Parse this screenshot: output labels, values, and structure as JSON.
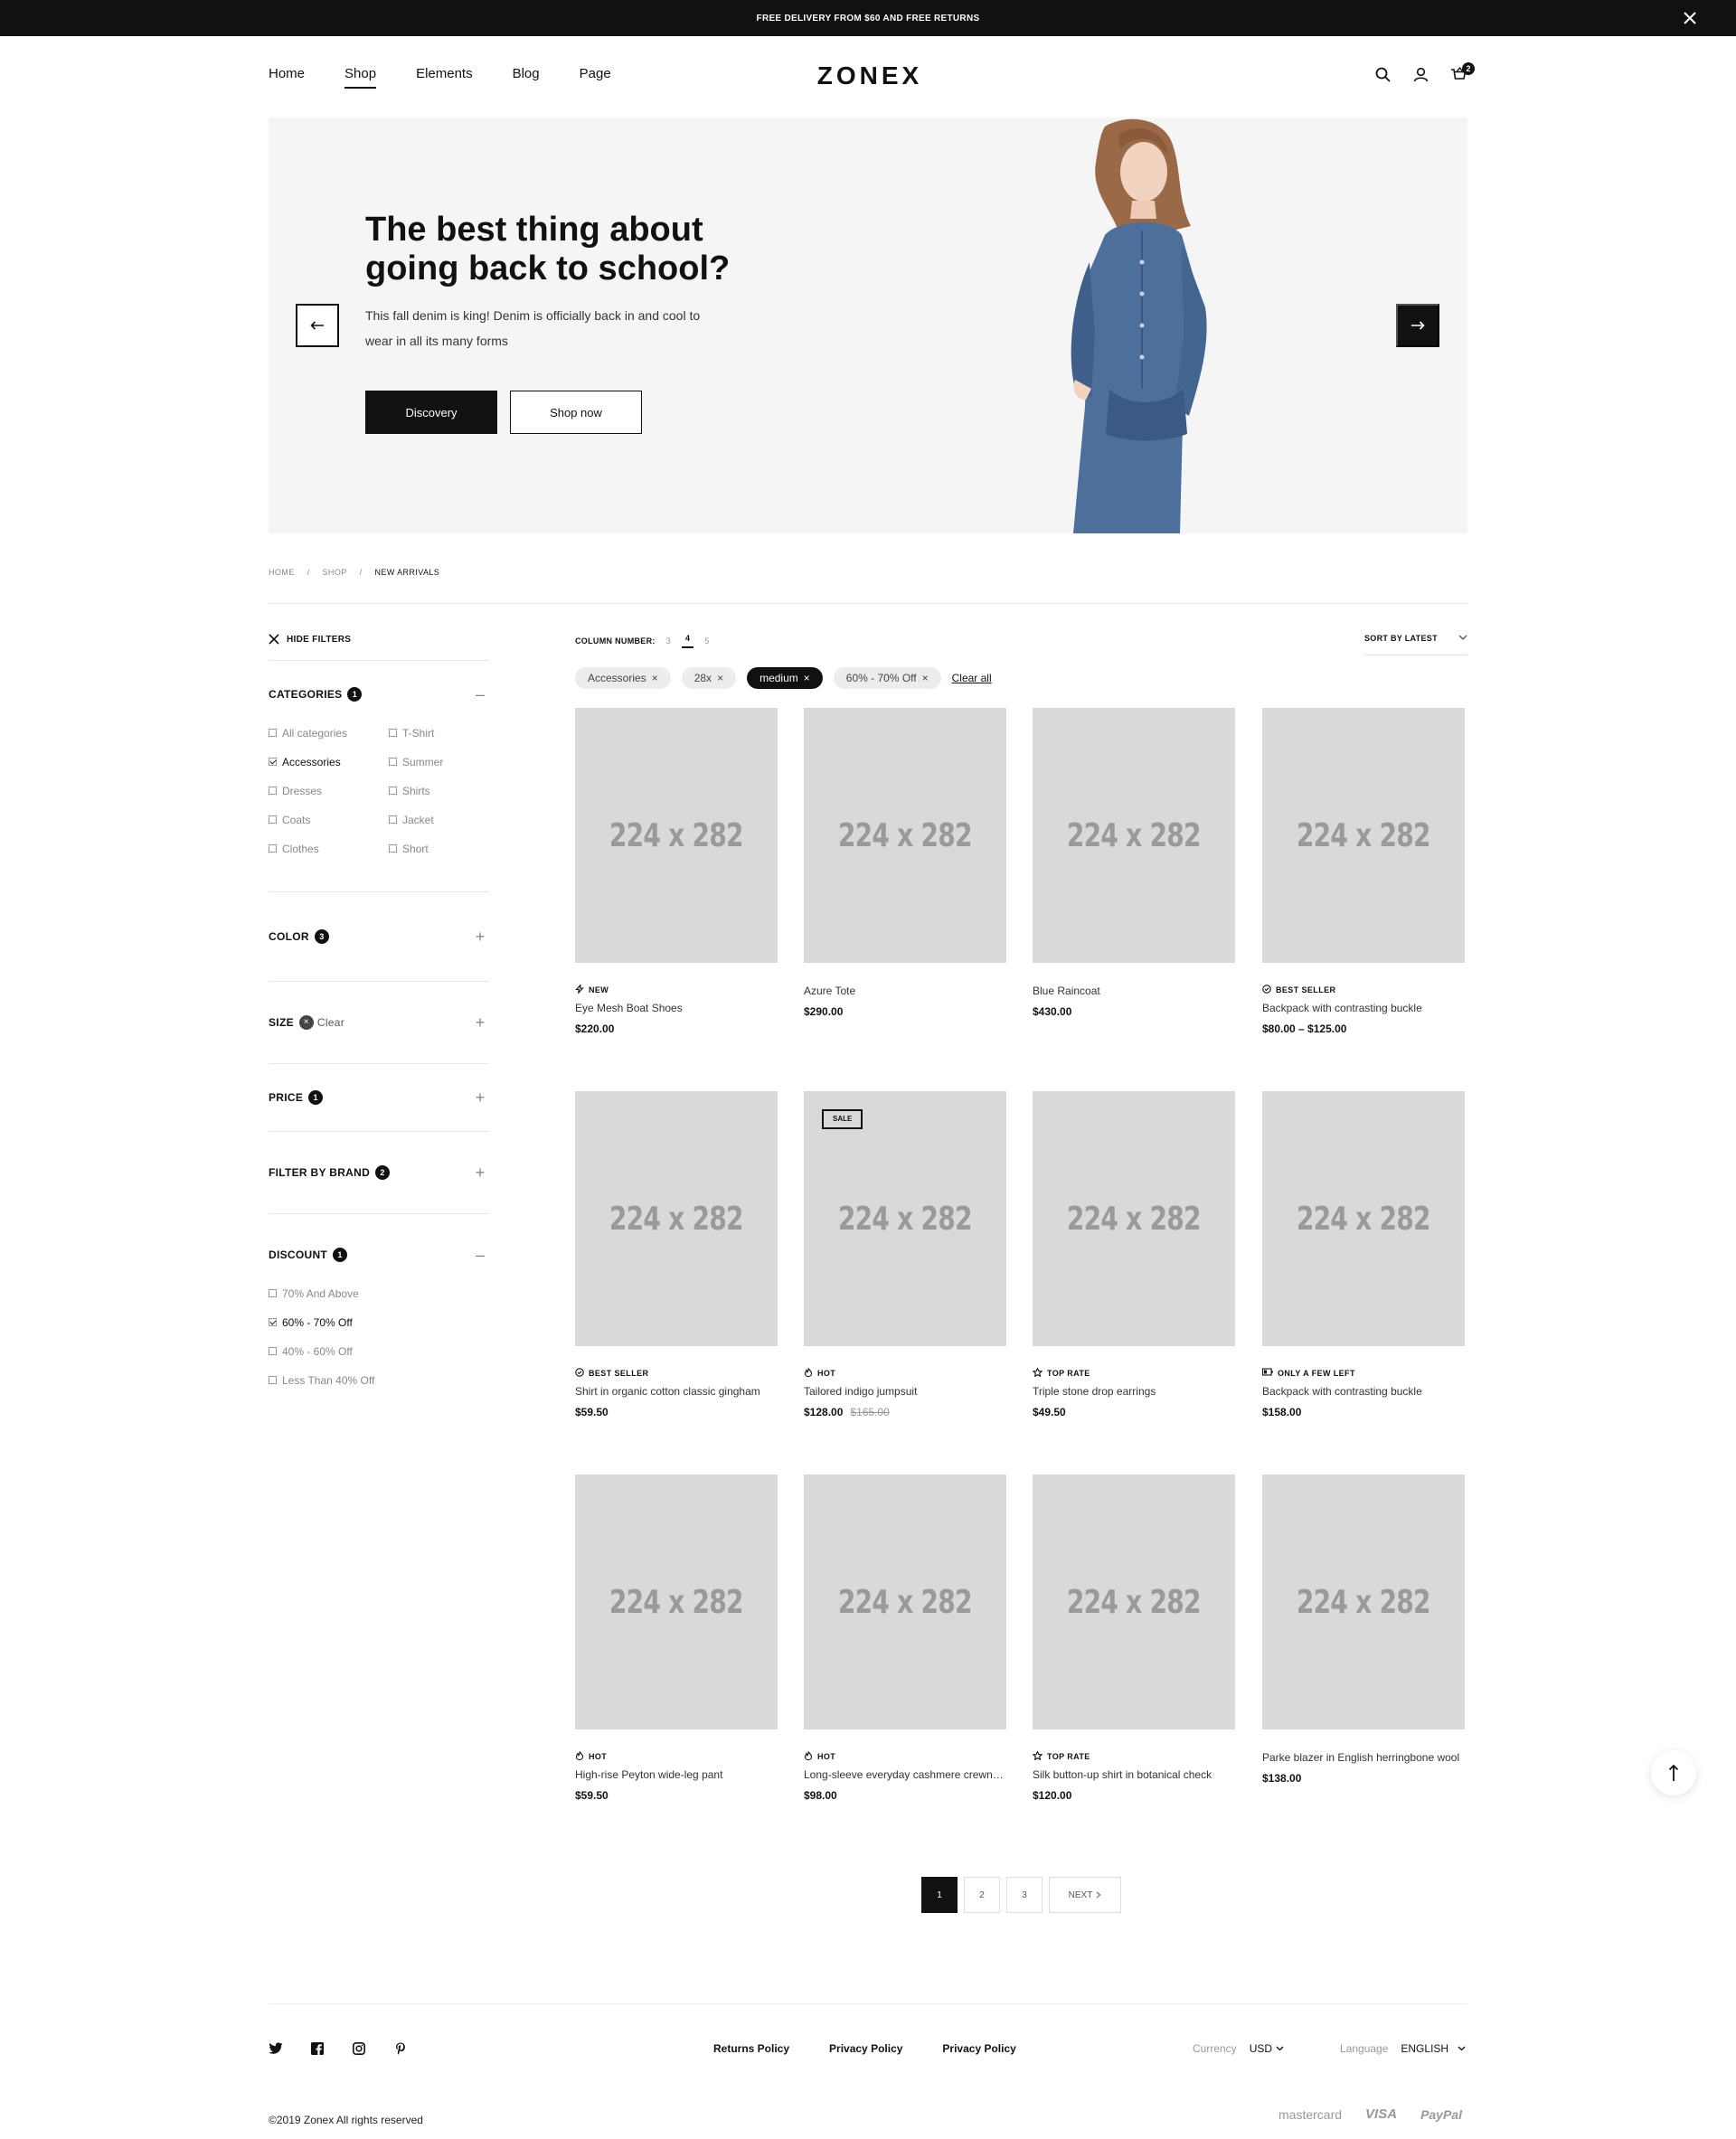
{
  "announcement": "FREE DELIVERY FROM $60 AND FREE RETURNS",
  "nav": [
    "Home",
    "Shop",
    "Elements",
    "Blog",
    "Page"
  ],
  "logo": "ZONEX",
  "cart_count": "2",
  "hero": {
    "title": "The best thing about going back to school?",
    "text": "This fall denim is king! Denim is officially back in and cool to wear in all its many forms",
    "btn_primary": "Discovery",
    "btn_secondary": "Shop now"
  },
  "breadcrumb": [
    "HOME",
    "/",
    "SHOP",
    "/",
    "NEW ARRIVALS"
  ],
  "filters": {
    "hide_label": "HIDE FILTERS",
    "categories": {
      "title": "CATEGORIES",
      "count": "1",
      "left": [
        {
          "label": "All categories",
          "checked": false
        },
        {
          "label": "Accessories",
          "checked": true
        },
        {
          "label": "Dresses",
          "checked": false
        },
        {
          "label": "Coats",
          "checked": false
        },
        {
          "label": "Clothes",
          "checked": false
        }
      ],
      "right": [
        {
          "label": "T-Shirt",
          "checked": false
        },
        {
          "label": "Summer",
          "checked": false
        },
        {
          "label": "Shirts",
          "checked": false
        },
        {
          "label": "Jacket",
          "checked": false
        },
        {
          "label": "Short",
          "checked": false
        }
      ]
    },
    "color": {
      "title": "COLOR",
      "count": "3"
    },
    "size": {
      "title": "SIZE",
      "clear": "Clear"
    },
    "price": {
      "title": "PRICE",
      "count": "1"
    },
    "brand": {
      "title": "FILTER BY BRAND",
      "count": "2"
    },
    "discount": {
      "title": "DISCOUNT",
      "count": "1",
      "options": [
        {
          "label": "70% And Above",
          "checked": false
        },
        {
          "label": "60% - 70% Off",
          "checked": true
        },
        {
          "label": "40% - 60% Off",
          "checked": false
        },
        {
          "label": "Less Than 40% Off",
          "checked": false
        }
      ]
    }
  },
  "toolbar": {
    "column_label": "COLUMN NUMBER:",
    "columns": [
      "3",
      "4",
      "5"
    ],
    "sort_label": "SORT BY LATEST"
  },
  "chips": [
    "Accessories",
    "28x",
    "medium",
    "60% - 70% Off"
  ],
  "clear_all": "Clear all",
  "placeholder_text": "224 x 282",
  "products": [
    {
      "tag": "NEW",
      "icon": "bolt-icon",
      "name": "Eye Mesh Boat Shoes",
      "price": "$220.00",
      "old": "",
      "sale": ""
    },
    {
      "tag": "",
      "icon": "",
      "name": "Azure Tote",
      "price": "$290.00",
      "old": "",
      "sale": ""
    },
    {
      "tag": "",
      "icon": "",
      "name": "Blue Raincoat",
      "price": "$430.00",
      "old": "",
      "sale": ""
    },
    {
      "tag": "BEST SELLER",
      "icon": "award-icon",
      "name": "Backpack with contrasting buckle",
      "price": "$80.00 – $125.00",
      "old": "",
      "sale": ""
    },
    {
      "tag": "BEST SELLER",
      "icon": "award-icon",
      "name": "Shirt in organic cotton classic gingham",
      "price": "$59.50",
      "old": "",
      "sale": ""
    },
    {
      "tag": "HOT",
      "icon": "flame-icon",
      "name": "Tailored indigo jumpsuit",
      "price": "$128.00",
      "old": "$165.00",
      "sale": "SALE"
    },
    {
      "tag": "TOP RATE",
      "icon": "star-icon",
      "name": "Triple stone drop earrings",
      "price": "$49.50",
      "old": "",
      "sale": ""
    },
    {
      "tag": "ONLY A FEW LEFT",
      "icon": "battery-icon",
      "name": "Backpack with contrasting buckle",
      "price": "$158.00",
      "old": "",
      "sale": ""
    },
    {
      "tag": "HOT",
      "icon": "flame-icon",
      "name": "High-rise Peyton wide-leg pant",
      "price": "$59.50",
      "old": "",
      "sale": ""
    },
    {
      "tag": "HOT",
      "icon": "flame-icon",
      "name": "Long-sleeve everyday cashmere crewneck",
      "price": "$98.00",
      "old": "",
      "sale": ""
    },
    {
      "tag": "TOP RATE",
      "icon": "star-icon",
      "name": "Silk button-up shirt in botanical check",
      "price": "$120.00",
      "old": "",
      "sale": ""
    },
    {
      "tag": "",
      "icon": "",
      "name": "Parke blazer in English herringbone wool",
      "price": "$138.00",
      "old": "",
      "sale": ""
    }
  ],
  "pagination": {
    "pages": [
      "1",
      "2",
      "3"
    ],
    "next": "NEXT"
  },
  "footer": {
    "links": [
      "Returns Policy",
      "Privacy Policy",
      "Privacy Policy"
    ],
    "currency_label": "Currency",
    "currency": "USD",
    "language_label": "Language",
    "language": "ENGLISH",
    "copyright": "©2019 Zonex All rights reserved",
    "payments": [
      "mastercard",
      "VISA",
      "PayPal"
    ]
  }
}
